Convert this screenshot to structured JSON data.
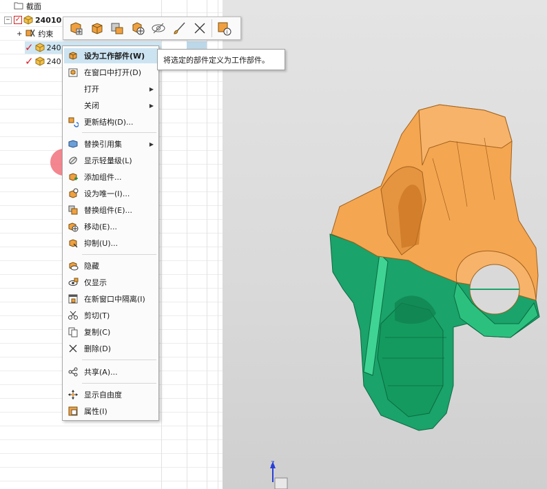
{
  "navigator": {
    "section_label": "截面",
    "root_label": "24010",
    "constraints_label": "约束",
    "child1_label": "240",
    "child1_suffix": "...",
    "child2_label": "240"
  },
  "mini_toolbar": {
    "icons": [
      "make-work-part-icon",
      "open-part-icon",
      "replace-component-icon",
      "move-component-icon",
      "hide-icon",
      "paint-brush-icon",
      "delete-icon",
      "properties-icon"
    ]
  },
  "context_menu": {
    "items": [
      {
        "label": "设为工作部件(W)",
        "icon": "make-work-part-icon",
        "highlight": true,
        "bold": true
      },
      {
        "label": "在窗口中打开(D)",
        "icon": "open-in-window-icon"
      },
      {
        "label": "打开",
        "submenu": true
      },
      {
        "label": "关闭",
        "submenu": true
      },
      {
        "label": "更新结构(D)...",
        "icon": "update-structure-icon"
      },
      {
        "label": "替换引用集",
        "icon": "replace-refset-icon",
        "submenu": true
      },
      {
        "label": "显示轻量级(L)",
        "icon": "lightweight-icon"
      },
      {
        "label": "添加组件...",
        "icon": "add-component-icon"
      },
      {
        "label": "设为唯一(I)...",
        "icon": "make-unique-icon"
      },
      {
        "label": "替换组件(E)...",
        "icon": "replace-component-icon"
      },
      {
        "label": "移动(E)...",
        "icon": "move-icon"
      },
      {
        "label": "抑制(U)...",
        "icon": "suppress-icon"
      },
      {
        "label": "隐藏",
        "icon": "hide-icon"
      },
      {
        "label": "仅显示",
        "icon": "show-only-icon"
      },
      {
        "label": "在新窗口中隔离(I)",
        "icon": "isolate-icon"
      },
      {
        "label": "剪切(T)",
        "icon": "cut-icon"
      },
      {
        "label": "复制(C)",
        "icon": "copy-icon"
      },
      {
        "label": "删除(D)",
        "icon": "delete-icon"
      },
      {
        "label": "共享(A)...",
        "icon": "share-icon"
      },
      {
        "label": "显示自由度",
        "icon": "dof-icon"
      },
      {
        "label": "属性(I)",
        "icon": "properties-icon"
      }
    ]
  },
  "tooltip": {
    "text": "将选定的部件定义为工作部件。"
  },
  "viewport": {
    "axis_label": "Z"
  },
  "colors": {
    "orange": "#f5a651",
    "green": "#1aa36a",
    "menu_highlight": "#cce4f2",
    "marker": "#f0646e"
  }
}
